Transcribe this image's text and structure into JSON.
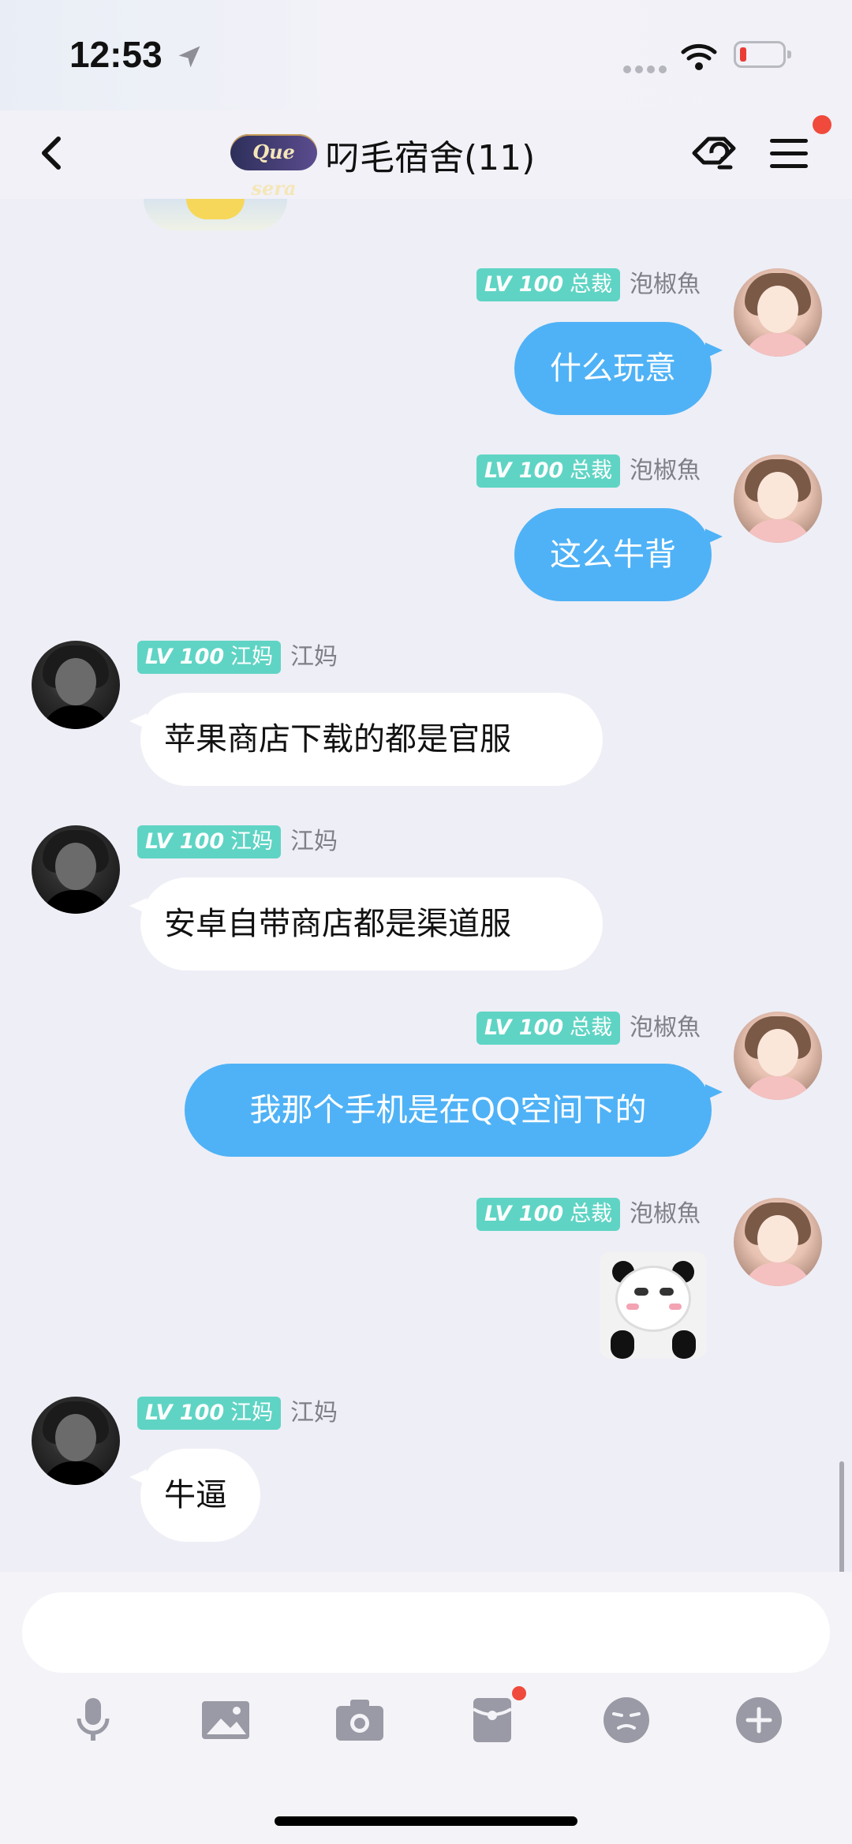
{
  "status_bar": {
    "time": "12:53"
  },
  "header": {
    "brand": "Que sera",
    "title": "叼毛宿舍(11)"
  },
  "level_label": "LV 100",
  "messages": [
    {
      "sender": "泡椒魚",
      "title": "总裁",
      "text": "什么玩意"
    },
    {
      "sender": "泡椒魚",
      "title": "总裁",
      "text": "这么牛背"
    },
    {
      "sender": "江妈",
      "title": "江妈",
      "text": "苹果商店下载的都是官服"
    },
    {
      "sender": "江妈",
      "title": "江妈",
      "text": "安卓自带商店都是渠道服"
    },
    {
      "sender": "泡椒魚",
      "title": "总裁",
      "text": "我那个手机是在QQ空间下的"
    },
    {
      "sender": "泡椒魚",
      "title": "总裁",
      "sticker": "panda-sticker"
    },
    {
      "sender": "江妈",
      "title": "江妈",
      "text": "牛逼"
    }
  ],
  "input": {
    "value": "",
    "placeholder": ""
  },
  "toolbar": [
    "microphone-icon",
    "image-icon",
    "camera-icon",
    "red-packet-icon",
    "emoji-icon",
    "plus-icon"
  ],
  "colors": {
    "my_bubble": "#4fb2f6",
    "their_bubble": "#ffffff",
    "badge": "#5fd4c4",
    "notification_dot": "#f04a3c"
  }
}
